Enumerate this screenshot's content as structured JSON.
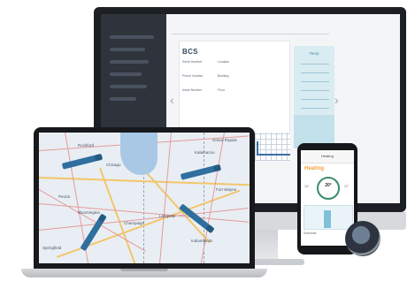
{
  "desktop": {
    "page_title": "BCS",
    "timeline_ticks": [
      "",
      "",
      "",
      "",
      "",
      ""
    ],
    "fields": [
      {
        "label": "Serial Number",
        "value": ""
      },
      {
        "label": "Location",
        "value": ""
      },
      {
        "label": "Phone Number",
        "value": ""
      },
      {
        "label": "Building",
        "value": ""
      },
      {
        "label": "Asset Number",
        "value": ""
      },
      {
        "label": "Floor",
        "value": ""
      }
    ],
    "temp_panel_title": "Temp",
    "temp_rows": [
      "",
      "",
      "",
      "",
      "",
      ""
    ],
    "prev_arrow": "‹",
    "next_arrow": "›"
  },
  "map": {
    "cities": [
      "Rockford",
      "Elgin",
      "Chicago",
      "Milwaukee",
      "Kalamazoo",
      "Grand Rapids",
      "Peoria",
      "Bloomington",
      "Indianapolis",
      "Springfield",
      "Champaign",
      "Fort Wayne",
      "Lafayette"
    ]
  },
  "phone": {
    "title": "Heating",
    "mode_label": "Heating",
    "setpoint": "20°",
    "left_label": "18°",
    "right_label": "22°",
    "footer": "Schedule"
  },
  "colors": {
    "map_water": "#a9c8e6",
    "truck": "#2f6f9e",
    "highway": "#f2c66b",
    "accent_heat": "#f0a33a"
  }
}
